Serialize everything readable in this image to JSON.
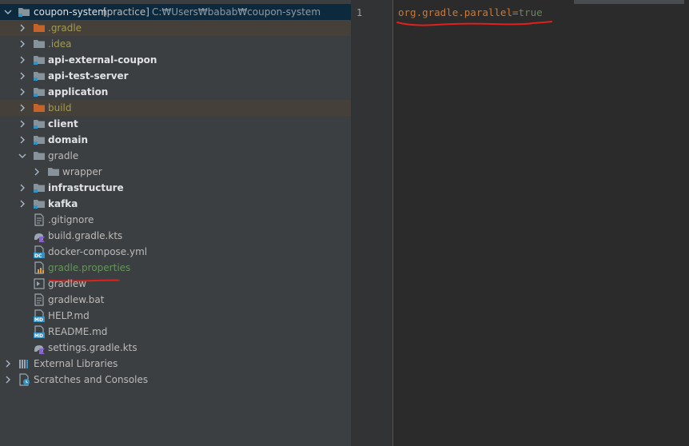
{
  "project": {
    "root_name": "coupon-system",
    "root_badge": "[practice]",
    "root_path": "C:₩Users₩babab₩coupon-system",
    "items": [
      {
        "label": ".gradle",
        "kind": "folder-excluded"
      },
      {
        "label": ".idea",
        "kind": "folder-excluded"
      },
      {
        "label": "api-external-coupon",
        "kind": "module"
      },
      {
        "label": "api-test-server",
        "kind": "module"
      },
      {
        "label": "application",
        "kind": "module"
      },
      {
        "label": "build",
        "kind": "folder-excluded"
      },
      {
        "label": "client",
        "kind": "module"
      },
      {
        "label": "domain",
        "kind": "module"
      },
      {
        "label": "gradle",
        "kind": "folder-open"
      },
      {
        "label": "wrapper",
        "kind": "folder"
      },
      {
        "label": "infrastructure",
        "kind": "module"
      },
      {
        "label": "kafka",
        "kind": "module"
      },
      {
        "label": ".gitignore",
        "kind": "file-text"
      },
      {
        "label": "build.gradle.kts",
        "kind": "file-gradle"
      },
      {
        "label": "docker-compose.yml",
        "kind": "file-docker"
      },
      {
        "label": "gradle.properties",
        "kind": "file-properties"
      },
      {
        "label": "gradlew",
        "kind": "file-shell"
      },
      {
        "label": "gradlew.bat",
        "kind": "file-text"
      },
      {
        "label": "HELP.md",
        "kind": "file-md"
      },
      {
        "label": "README.md",
        "kind": "file-md"
      },
      {
        "label": "settings.gradle.kts",
        "kind": "file-gradle"
      }
    ],
    "external_libraries": "External Libraries",
    "scratches": "Scratches and Consoles"
  },
  "editor": {
    "line_number": "1",
    "code_key": "org.gradle.parallel",
    "code_eq": "=",
    "code_value": "true"
  },
  "colors": {
    "accent_red_annotation": "#e0201b",
    "excluded_folder": "#a59b49",
    "selected_row": "#0d293e"
  }
}
